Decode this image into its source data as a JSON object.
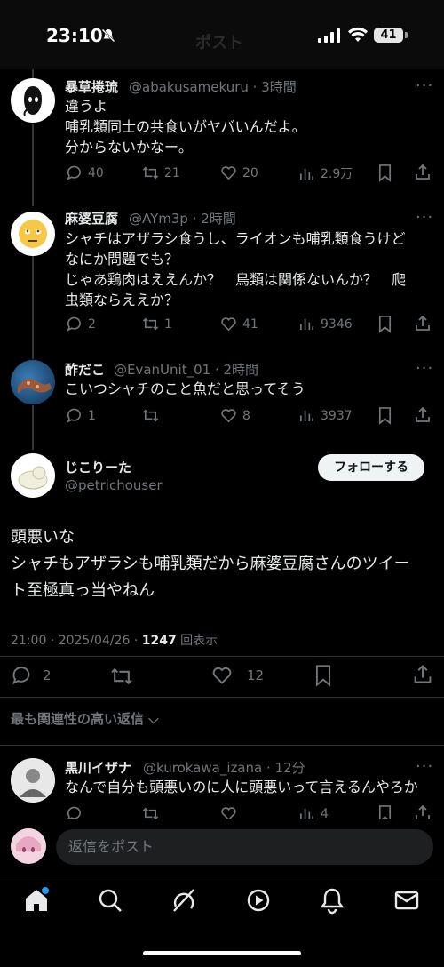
{
  "status": {
    "time": "23:10",
    "battery": "41",
    "ghost_title": "ポスト"
  },
  "replies": [
    {
      "name": "暴草捲琉",
      "handle": "@abakusamekuru · 3時間",
      "lines": [
        "違うよ",
        "哺乳類同士の共食いがヤバいんだよ。",
        "分からないかなー。"
      ],
      "replies": "40",
      "reposts": "21",
      "likes": "20",
      "views": "2.9万"
    },
    {
      "name": "麻婆豆腐",
      "handle": "@AYm3p · 2時間",
      "lines": [
        "シャチはアザラシ食うし、ライオンも哺乳類食うけど",
        "なにか問題でも？",
        "じゃあ鶏肉はええんか？　鳥類は関係ないんか？　爬",
        "虫類ならええか？"
      ],
      "replies": "2",
      "reposts": "1",
      "likes": "41",
      "views": "9346"
    },
    {
      "name": "酢だこ",
      "handle": "@EvanUnit_01 · 2時間",
      "lines": [
        "こいつシャチのこと魚だと思ってそう"
      ],
      "replies": "1",
      "reposts": "",
      "likes": "8",
      "views": "3937"
    }
  ],
  "main": {
    "name": "じこりーた",
    "handle": "@petrichouser",
    "follow_label": "フォローする",
    "lines": [
      "頭悪いな",
      "シャチもアザラシも哺乳類だから麻婆豆腐さんのツイー",
      "ト至極真っ当やねん"
    ],
    "timestamp": "21:00 · 2025/04/26 · ",
    "views_count": "1247",
    "views_label": "回表示",
    "replies": "2",
    "likes": "12"
  },
  "sort_label": "最も関連性の高い返信",
  "next_reply": {
    "name": "黒川イザナ",
    "handle": "@kurokawa_izana · 12分",
    "line": "なんで自分も頭悪いのに人に頭悪いって言えるんやろか",
    "views": "4"
  },
  "reply_placeholder": "返信をポスト",
  "colors": {
    "background": "#000000",
    "text": "#e7e9ea",
    "muted": "#71767b",
    "notification_dot": "#1d9bf0"
  }
}
